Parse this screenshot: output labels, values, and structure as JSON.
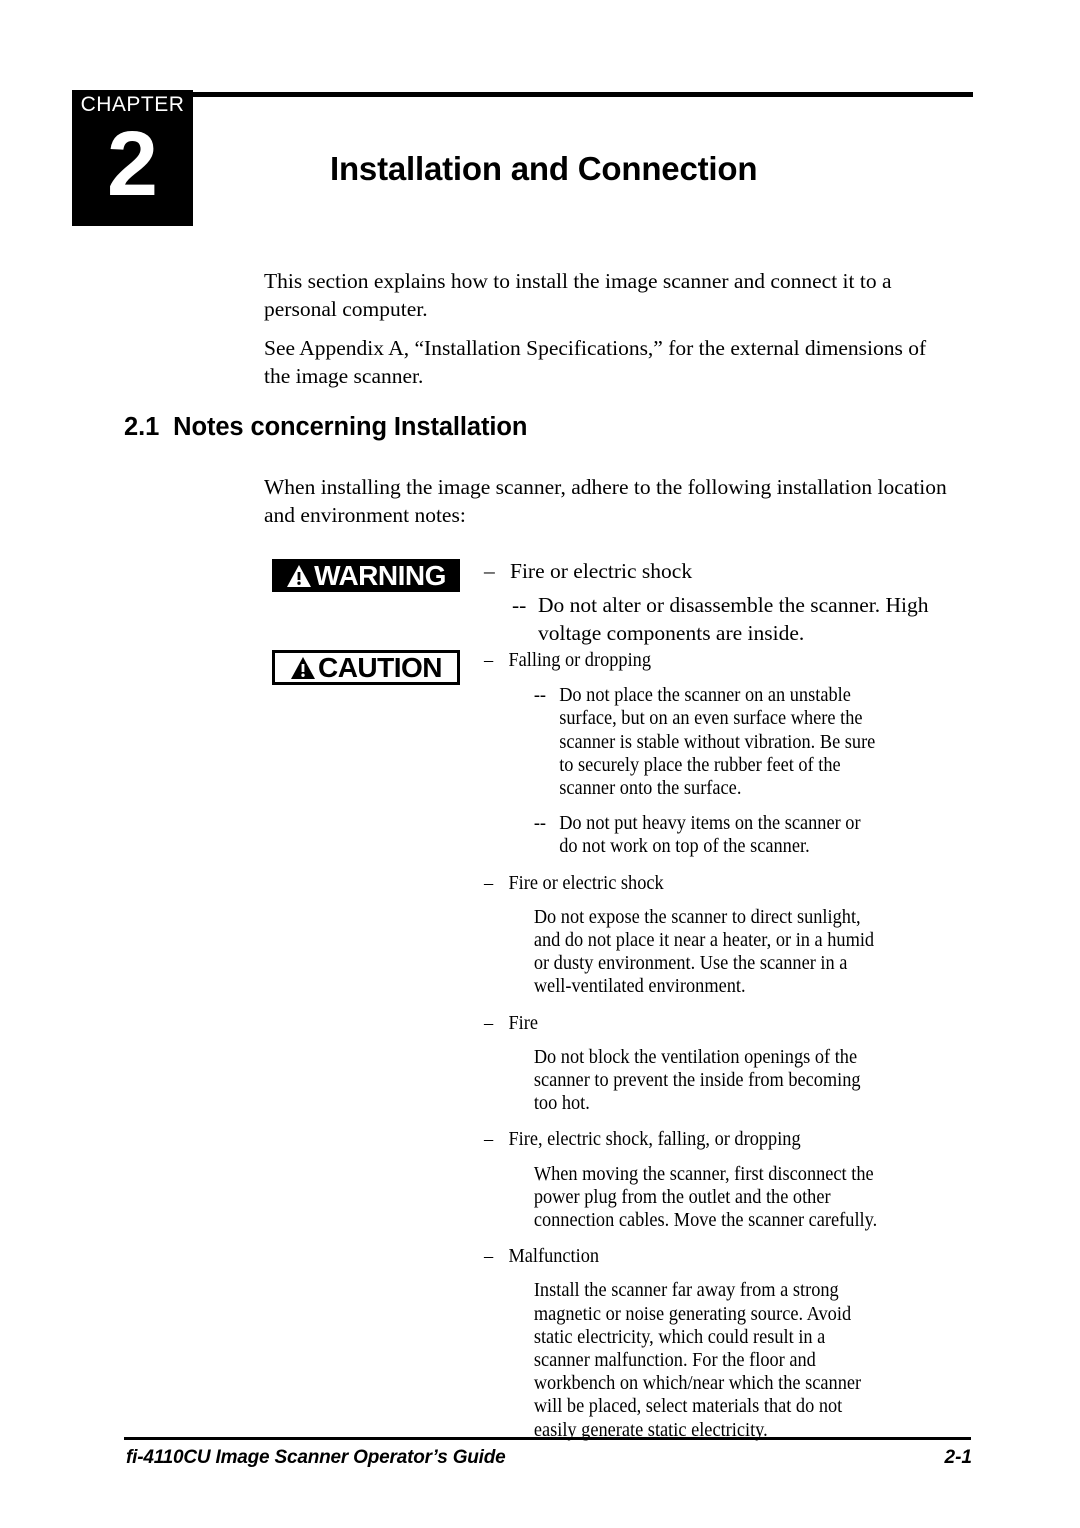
{
  "chapter": {
    "word": "CHAPTER",
    "number": "2",
    "title": "Installation and Connection"
  },
  "intro": {
    "paragraph_1": "This section explains how to install the image scanner and connect it to a personal computer.",
    "paragraph_2": "See Appendix A, “Installation Specifications,” for the external dimensions of the image scanner."
  },
  "section": {
    "number": "2.1",
    "heading": "Notes concerning Installation",
    "intro": "When installing the image scanner, adhere to the following installation location and environment notes:"
  },
  "warning": {
    "label": "WARNING",
    "icon": "warning-triangle-icon",
    "items": [
      {
        "dash": "–",
        "title": "Fire or electric shock",
        "sub_dash": "--",
        "sub_text": "Do not alter or disassemble the scanner. High voltage components are inside."
      }
    ]
  },
  "caution": {
    "label": "CAUTION",
    "icon": "warning-triangle-icon",
    "items": [
      {
        "dash": "–",
        "title": "Falling or dropping",
        "subs": [
          {
            "dash": "--",
            "text": "Do not place the scanner on an unstable surface, but on an even surface where the scanner is stable without vibration.  Be sure to securely place the rubber feet of the scanner onto the surface."
          },
          {
            "dash": "--",
            "text": "Do not put heavy items on the scanner or do not work on top of the scanner."
          }
        ]
      },
      {
        "dash": "–",
        "title": "Fire or electric shock",
        "body": "Do not expose the scanner to direct sunlight, and do not place it near a heater, or in a humid or dusty environment.  Use the scanner in a well-ventilated environment."
      },
      {
        "dash": "–",
        "title": "Fire",
        "body": "Do not block the ventilation openings of the scanner to prevent the inside from becoming too hot."
      },
      {
        "dash": "–",
        "title": "Fire, electric shock, falling, or dropping",
        "body": "When moving the scanner, first disconnect  the power plug from the outlet and the other connection cables.  Move the scanner carefully."
      },
      {
        "dash": "–",
        "title": "Malfunction",
        "body": "Install the scanner far away from a strong magnetic or noise generating source.  Avoid static electricity, which could result in a scanner malfunction.  For the floor and workbench on which/near which the scanner will be placed, select materials that do not easily generate static electricity."
      }
    ]
  },
  "footer": {
    "document_title": "fi-4110CU Image Scanner Operator’s Guide",
    "page_number": "2-1"
  }
}
